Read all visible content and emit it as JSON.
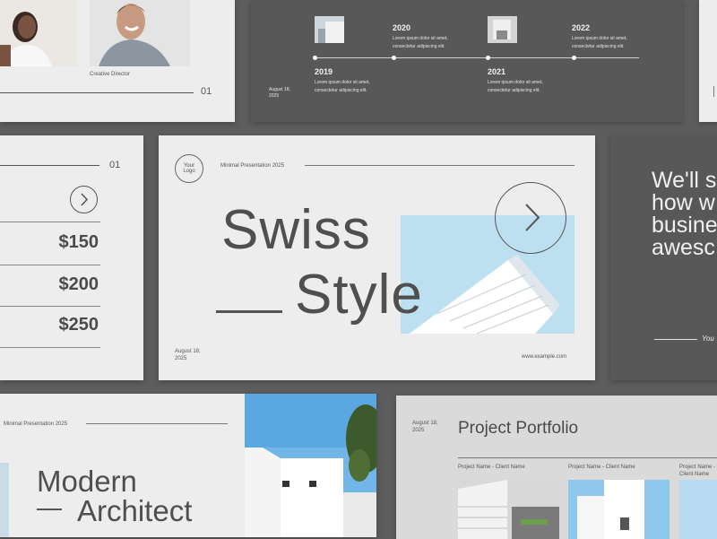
{
  "colors": {
    "background": "#5d5d5d",
    "slide_light": "#ededee",
    "slide_dark": "#585858",
    "text_dark": "#4a4a4a",
    "sky_blue": "#bcdff0"
  },
  "top_left": {
    "caption": "Creative Director",
    "page_number": "01"
  },
  "timeline": {
    "date": "August 18,\n2025",
    "items": [
      {
        "year": "2019",
        "text": "Lorem ipsum dolor sit amet,\nconsectetur adipiscing elit."
      },
      {
        "year": "2020",
        "text": "Lorem ipsum dolor sit amet,\nconsectetur adipiscing elit."
      },
      {
        "year": "2021",
        "text": "Lorem ipsum dolor sit amet,\nconsectetur adipiscing elit."
      },
      {
        "year": "2022",
        "text": "Lorem ipsum dolor sit amet,\nconsectetur adipiscing elit."
      }
    ]
  },
  "pricing": {
    "page_number": "01",
    "prices": [
      "$150",
      "$200",
      "$250"
    ]
  },
  "main": {
    "logo": "Your\nLogo",
    "subtitle": "Minimal Presentation 2025",
    "title_line1": "Swiss",
    "title_line2": "Style",
    "date": "August 18,\n2025",
    "website": "www.example.com"
  },
  "quote": {
    "text": "We'll s\nhow w\nbusine\nawesc",
    "caption": "You"
  },
  "architect": {
    "subtitle": "Minimal Presentation 2025",
    "title_line1": "Modern",
    "title_line2": "Architect"
  },
  "portfolio": {
    "date": "August 18,\n2025",
    "title": "Project Portfolio",
    "labels": [
      "Project Name - Client Name",
      "Project Name - Client Name",
      "Project Name - Client Name"
    ]
  },
  "icons": {
    "arrow": "chevron-right-icon"
  }
}
